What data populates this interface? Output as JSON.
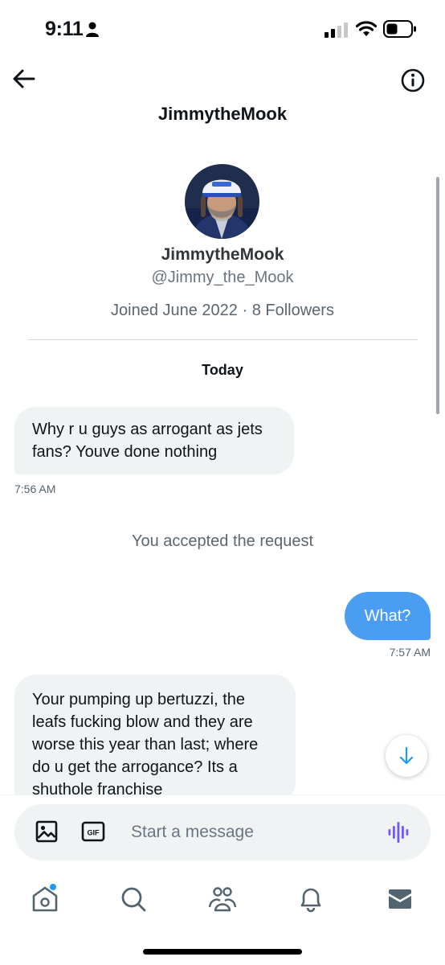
{
  "status_bar": {
    "time": "9:11"
  },
  "header": {
    "title": "JimmytheMook"
  },
  "profile": {
    "name": "JimmytheMook",
    "handle": "@Jimmy_the_Mook",
    "meta": "Joined June 2022 · 8 Followers"
  },
  "conversation": {
    "date_label": "Today",
    "messages": [
      {
        "direction": "incoming",
        "text": "Why r u guys as arrogant as jets fans? Youve done nothing",
        "time": "7:56 AM"
      },
      {
        "direction": "system",
        "text": "You accepted the request"
      },
      {
        "direction": "outgoing",
        "text": "What?",
        "time": "7:57 AM"
      },
      {
        "direction": "incoming",
        "text": "Your pumping up bertuzzi, the leafs fucking blow and they are worse this year than last; where do u get the arrogance? Its a shuthole franchise"
      }
    ]
  },
  "composer": {
    "placeholder": "Start a message"
  },
  "tabs": [
    "home-icon",
    "search-icon",
    "communities-icon",
    "notifications-icon",
    "messages-icon"
  ],
  "colors": {
    "accent": "#1d9bf0",
    "outgoing_bubble": "#4a9df0",
    "incoming_bubble": "#eff3f4",
    "voice_purple": "#7856ff"
  }
}
